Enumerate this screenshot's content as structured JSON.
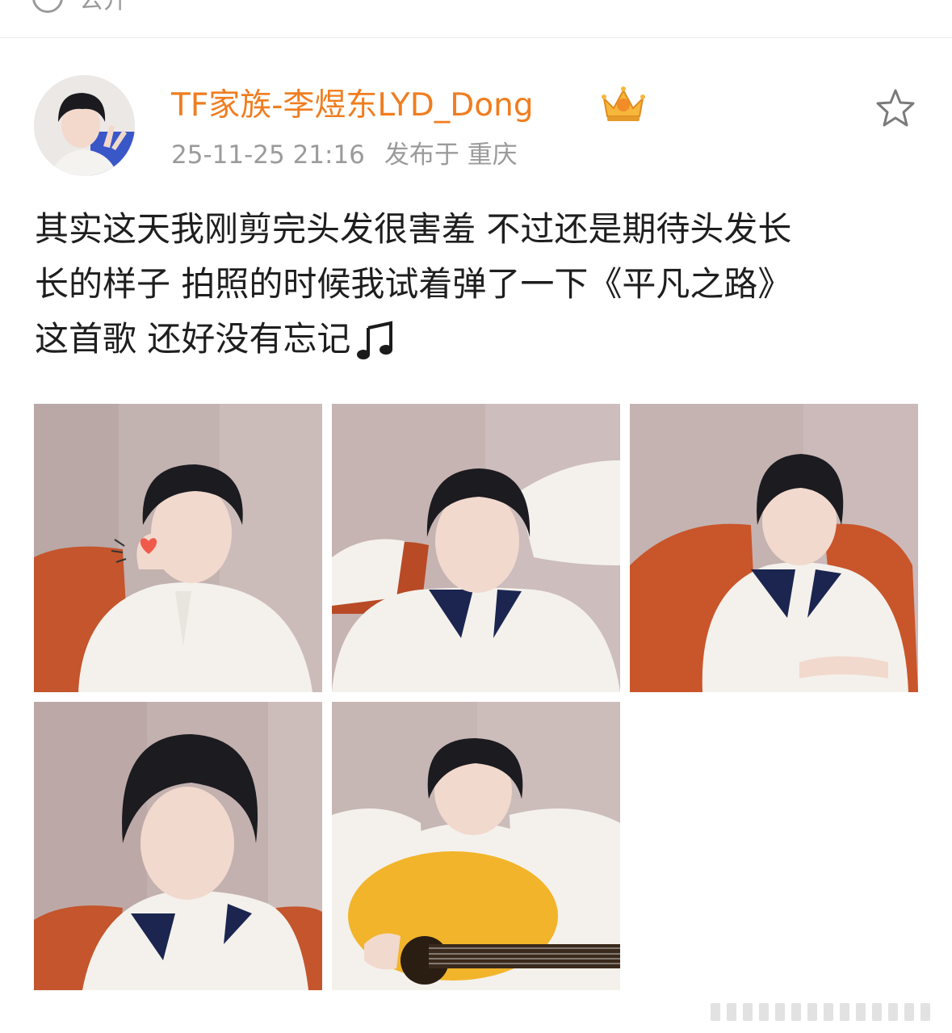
{
  "top_bar": {
    "visibility_label": "公开"
  },
  "post": {
    "author": {
      "name": "TF家族-李煜东LYD_Dong",
      "badge_icon": "crown-icon"
    },
    "timestamp": "25-11-25 21:16",
    "location": "发布于 重庆",
    "favorite_icon": "star-icon",
    "text_lines": [
      "其实这天我刚剪完头发很害羞 不过还是期待头发长",
      "长的样子 拍照的时候我试着弹了一下《平凡之路》",
      "这首歌 还好没有忘记"
    ],
    "emoji_icon": "music-note-icon",
    "image_count": 5
  },
  "colors": {
    "author_name": "#f07d1f",
    "meta_text": "#9b9b9b",
    "body_text": "#1e1e1e",
    "wall": "#c8b8b6",
    "sofa": "#c85a30",
    "sweater": "#f4f1ec",
    "collar": "#1b2550",
    "guitar": "#f2b42a"
  }
}
